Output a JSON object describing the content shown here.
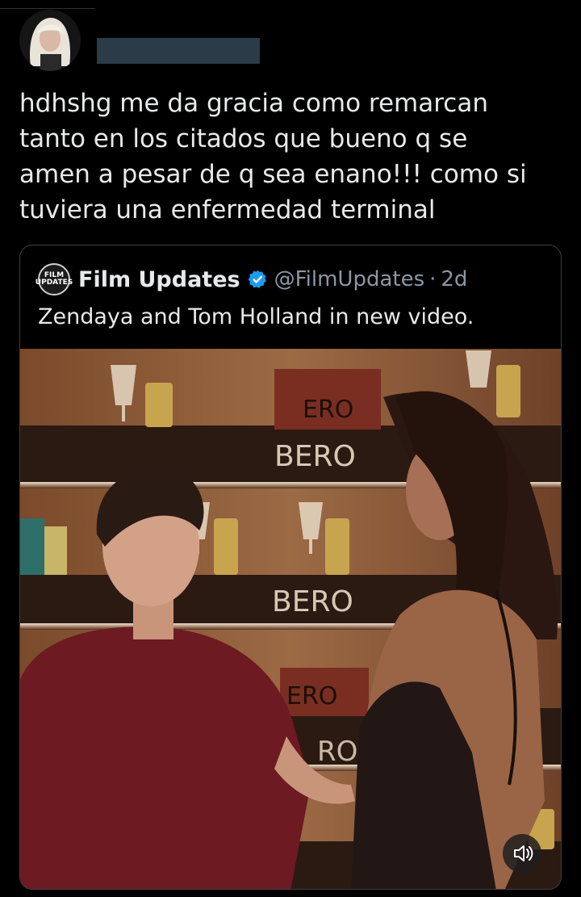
{
  "tweet": {
    "text": "hdhshg me da gracia como remarcan\ntanto en los citados que bueno q se\namen a pesar de q sea enano!!! como si\ntuviera una enfermedad terminal"
  },
  "quote": {
    "logo_text": "FILM UPDATES",
    "name": "Film Updates",
    "handle": "@FilmUpdates",
    "separator": "·",
    "time": "2d",
    "text": "Zendaya and Tom Holland in new video.",
    "verified_color": "#1d9bf0"
  },
  "media": {
    "signs": [
      "BERO",
      "BERO",
      "ERO",
      "ERO",
      "RO"
    ],
    "sound_icon": "speaker-muted-icon"
  }
}
